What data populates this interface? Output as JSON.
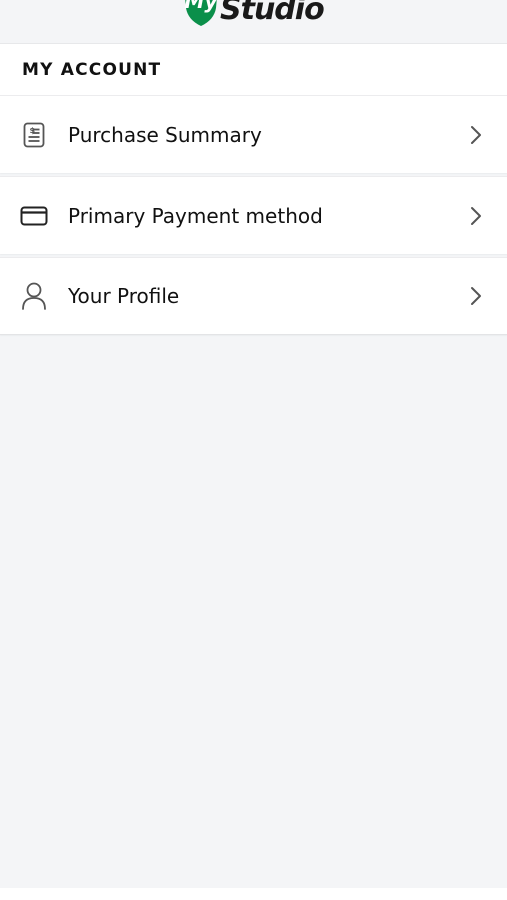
{
  "header": {
    "logo_text": "Studio",
    "logo_mark": "My",
    "logo_color": "#0a8f4a"
  },
  "section": {
    "title": "MY ACCOUNT"
  },
  "menu": {
    "items": [
      {
        "label": "Purchase Summary",
        "icon": "receipt-icon"
      },
      {
        "label": "Primary Payment method",
        "icon": "credit-card-icon"
      },
      {
        "label": "Your Profile",
        "icon": "user-icon"
      }
    ]
  },
  "colors": {
    "background": "#f4f5f7",
    "surface": "#ffffff",
    "icon": "#555555",
    "text": "#111111"
  }
}
